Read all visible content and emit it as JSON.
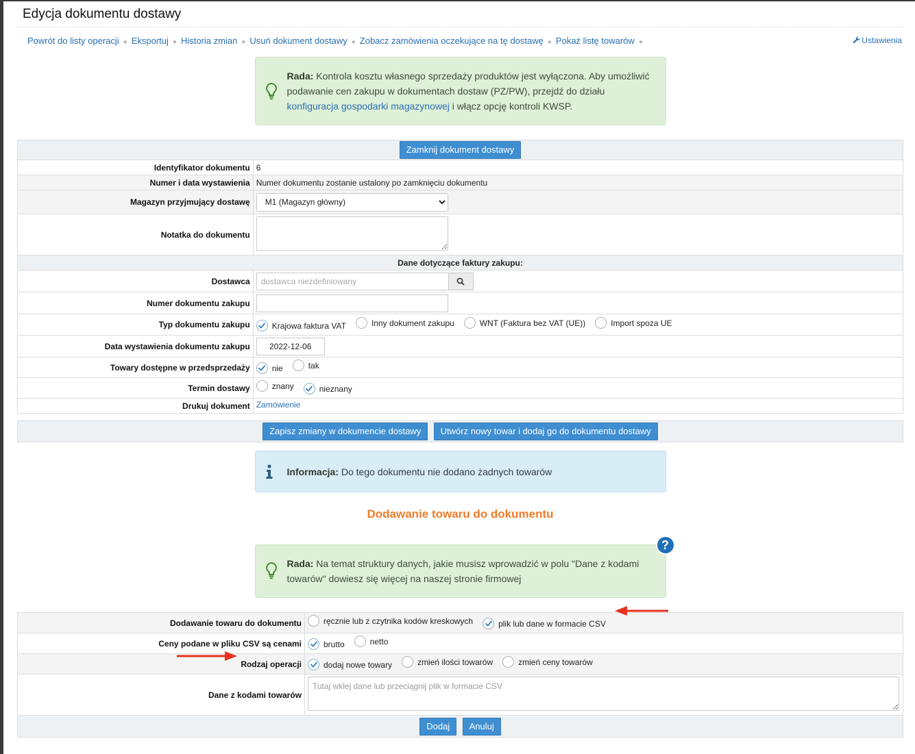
{
  "page_title": "Edycja dokumentu dostawy",
  "nav": {
    "links": [
      "Powrót do listy operacji",
      "Eksportuj",
      "Historia zmian",
      "Usuń dokument dostawy",
      "Zobacz zamówienia oczekujące na tę dostawę",
      "Pokaż listę towarów"
    ],
    "settings": "Ustawienia"
  },
  "tip1": {
    "title": "Rada:",
    "text_before": " Kontrola kosztu własnego sprzedaży produktów jest wyłączona. Aby umożliwić podawanie cen zakupu w dokumentach dostaw (PZ/PW), przejdź do działu ",
    "link": "konfiguracja gospodarki magazynowej",
    "text_after": " i włącz opcję kontroli KWSP."
  },
  "doc_form": {
    "close_button": "Zamknij dokument dostawy",
    "id_label": "Identyfikator dokumentu",
    "id_value": "6",
    "number_label": "Numer i data wystawienia",
    "number_value": "Numer dokumentu zostanie ustalony po zamknięciu dokumentu",
    "warehouse_label": "Magazyn przyjmujący dostawę",
    "warehouse_value": "M1 (Magazyn główny)",
    "note_label": "Notatka do dokumentu",
    "invoice_header": "Dane dotyczące faktury zakupu:",
    "supplier_label": "Dostawca",
    "supplier_placeholder": "dostawca niezdefiniowany",
    "purchase_number_label": "Numer dokumentu zakupu",
    "doc_type_label": "Typ dokumentu zakupu",
    "doc_types": [
      {
        "label": "Krajowa faktura VAT",
        "checked": true
      },
      {
        "label": "Inny dokument zakupu",
        "checked": false
      },
      {
        "label": "WNT (Faktura bez VAT (UE))",
        "checked": false
      },
      {
        "label": "Import spoza UE",
        "checked": false
      }
    ],
    "issue_date_label": "Data wystawienia dokumentu zakupu",
    "issue_date_value": "2022-12-06",
    "presale_label": "Towary dostępne w przedsprzedaży",
    "presale_options": [
      {
        "label": "nie",
        "checked": true
      },
      {
        "label": "tak",
        "checked": false
      }
    ],
    "delivery_label": "Termin dostawy",
    "delivery_options": [
      {
        "label": "znany",
        "checked": false
      },
      {
        "label": "nieznany",
        "checked": true
      }
    ],
    "print_label": "Drukuj dokument",
    "print_link": "Zamówienie"
  },
  "actions": {
    "save": "Zapisz zmiany w dokumencie dostawy",
    "create": "Utwórz nowy towar i dodaj go do dokumentu dostawy"
  },
  "info": {
    "title": "Informacja:",
    "text": " Do tego dokumentu nie dodano żadnych towarów"
  },
  "section_title": "Dodawanie towaru do dokumentu",
  "tip2": {
    "title": "Rada:",
    "text": " Na temat struktury danych, jakie musisz wprowadzić w polu \"Dane z kodami towarów\" dowiesz się więcej na naszej stronie firmowej"
  },
  "add_form": {
    "method_label": "Dodawanie towaru do dokumentu",
    "methods": [
      {
        "label": "ręcznie lub z czytnika kodów kreskowych",
        "checked": false
      },
      {
        "label": "plik lub dane w formacie CSV",
        "checked": true
      }
    ],
    "prices_label": "Ceny podane w pliku CSV są cenami",
    "prices": [
      {
        "label": "brutto",
        "checked": true
      },
      {
        "label": "netto",
        "checked": false
      }
    ],
    "operation_label": "Rodzaj operacji",
    "operations": [
      {
        "label": "dodaj nowe towary",
        "checked": true
      },
      {
        "label": "zmień ilości towarów",
        "checked": false
      },
      {
        "label": "zmień ceny towarów",
        "checked": false
      }
    ],
    "codes_label": "Dane z kodami towarów",
    "codes_placeholder": "Tutaj wklej dane lub przeciągnij plik w formacie CSV",
    "add_button": "Dodaj",
    "cancel_button": "Anuluj"
  },
  "colors": {
    "accent": "#3f8ed1",
    "link": "#2a6fb0",
    "heading": "#f07c28",
    "annotation_arrow": "#e8311f"
  }
}
